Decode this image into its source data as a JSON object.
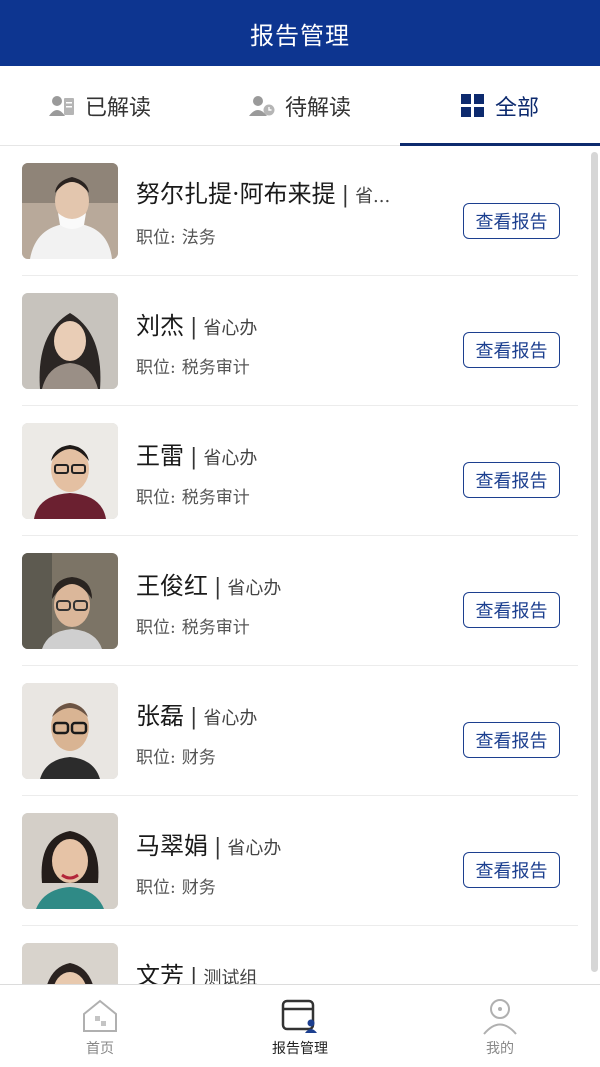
{
  "header": {
    "title": "报告管理"
  },
  "tabs": [
    {
      "label": "已解读",
      "icon": "person-read-icon"
    },
    {
      "label": "待解读",
      "icon": "person-pending-icon"
    },
    {
      "label": "全部",
      "icon": "grid-icon",
      "active": true
    }
  ],
  "people": [
    {
      "name": "努尔扎提·阿布来提",
      "dept": "省...",
      "position_label": "职位:",
      "position": "法务",
      "button": "查看报告"
    },
    {
      "name": "刘杰",
      "dept": "省心办",
      "position_label": "职位:",
      "position": "税务审计",
      "button": "查看报告"
    },
    {
      "name": "王雷",
      "dept": "省心办",
      "position_label": "职位:",
      "position": "税务审计",
      "button": "查看报告"
    },
    {
      "name": "王俊红",
      "dept": "省心办",
      "position_label": "职位:",
      "position": "税务审计",
      "button": "查看报告"
    },
    {
      "name": "张磊",
      "dept": "省心办",
      "position_label": "职位:",
      "position": "财务",
      "button": "查看报告"
    },
    {
      "name": "马翠娟",
      "dept": "省心办",
      "position_label": "职位:",
      "position": "财务",
      "button": "查看报告"
    },
    {
      "name": "文芳",
      "dept": "测试组",
      "position_label": "",
      "position": "",
      "button": ""
    }
  ],
  "separator": "|",
  "bottom_nav": [
    {
      "label": "首页",
      "icon": "home-icon"
    },
    {
      "label": "报告管理",
      "icon": "report-manage-icon",
      "active": true
    },
    {
      "label": "我的",
      "icon": "profile-icon"
    }
  ],
  "colors": {
    "brand": "#0d3590",
    "accent": "#1c3f8f"
  }
}
